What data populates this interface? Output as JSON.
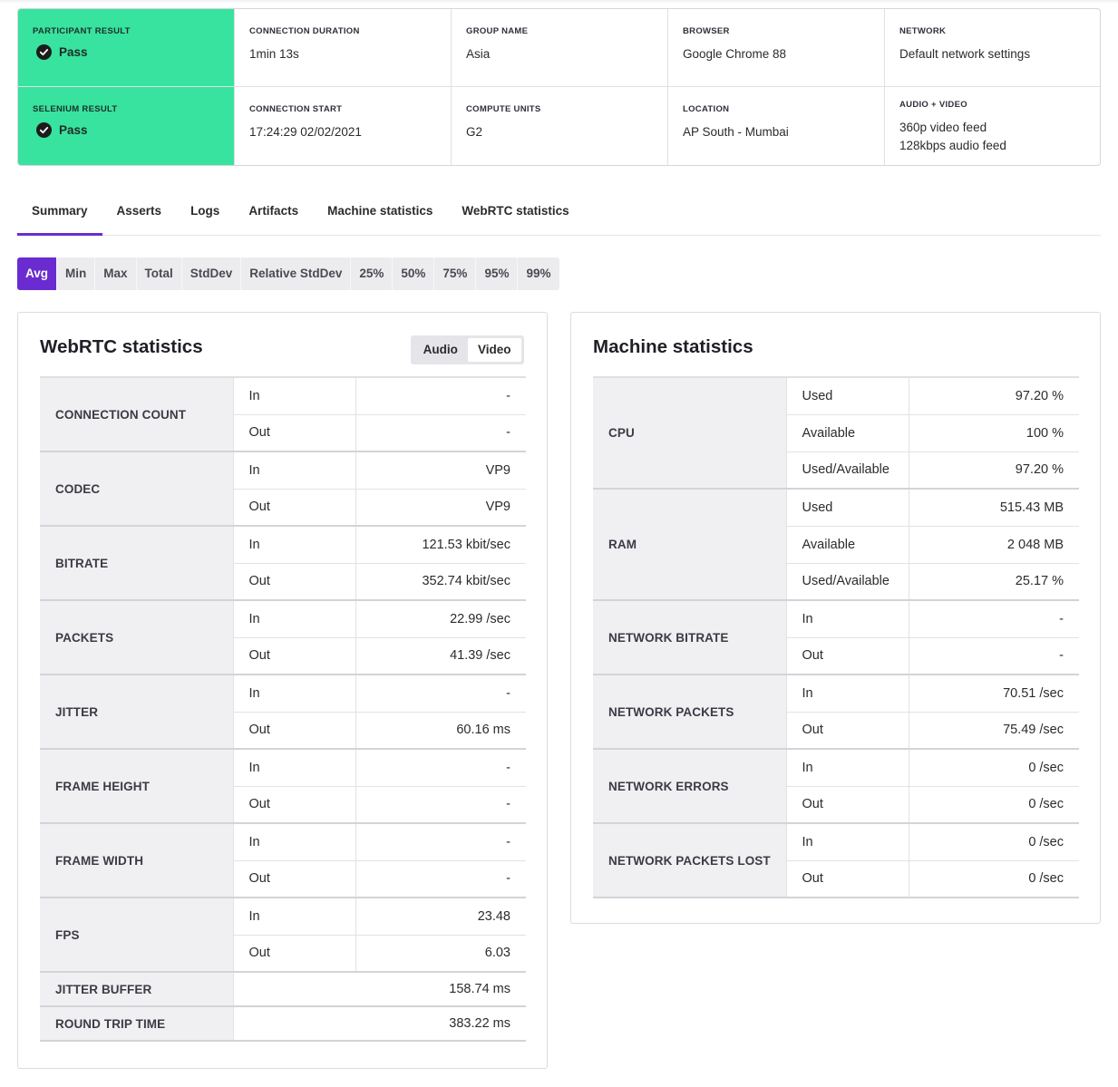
{
  "info": {
    "participant_result": {
      "label": "PARTICIPANT RESULT",
      "value": "Pass"
    },
    "connection_duration": {
      "label": "CONNECTION DURATION",
      "value": "1min 13s"
    },
    "group_name": {
      "label": "GROUP NAME",
      "value": "Asia"
    },
    "browser": {
      "label": "BROWSER",
      "value": "Google Chrome 88"
    },
    "network": {
      "label": "NETWORK",
      "value": "Default network settings"
    },
    "selenium_result": {
      "label": "SELENIUM RESULT",
      "value": "Pass"
    },
    "connection_start": {
      "label": "CONNECTION START",
      "value": "17:24:29 02/02/2021"
    },
    "compute_units": {
      "label": "COMPUTE UNITS",
      "value": "G2"
    },
    "location": {
      "label": "LOCATION",
      "value": "AP South - Mumbai"
    },
    "audio_video": {
      "label": "AUDIO + VIDEO",
      "value_line1": "360p video feed",
      "value_line2": "128kbps audio feed"
    }
  },
  "tabs": [
    "Summary",
    "Asserts",
    "Logs",
    "Artifacts",
    "Machine statistics",
    "WebRTC statistics"
  ],
  "active_tab": "Summary",
  "stat_tabs": [
    "Avg",
    "Min",
    "Max",
    "Total",
    "StdDev",
    "Relative StdDev",
    "25%",
    "50%",
    "75%",
    "95%",
    "99%"
  ],
  "active_stat": "Avg",
  "webrtc": {
    "title": "WebRTC statistics",
    "toggle": [
      "Audio",
      "Video"
    ],
    "active_toggle": "Video",
    "groups": [
      {
        "metric": "CONNECTION COUNT",
        "rows": [
          {
            "dir": "In",
            "value": "-"
          },
          {
            "dir": "Out",
            "value": "-"
          }
        ]
      },
      {
        "metric": "CODEC",
        "rows": [
          {
            "dir": "In",
            "value": "VP9"
          },
          {
            "dir": "Out",
            "value": "VP9"
          }
        ]
      },
      {
        "metric": "BITRATE",
        "rows": [
          {
            "dir": "In",
            "value": "121.53 kbit/sec"
          },
          {
            "dir": "Out",
            "value": "352.74 kbit/sec"
          }
        ]
      },
      {
        "metric": "PACKETS",
        "rows": [
          {
            "dir": "In",
            "value": "22.99 /sec"
          },
          {
            "dir": "Out",
            "value": "41.39 /sec"
          }
        ]
      },
      {
        "metric": "JITTER",
        "rows": [
          {
            "dir": "In",
            "value": "-"
          },
          {
            "dir": "Out",
            "value": "60.16 ms"
          }
        ]
      },
      {
        "metric": "FRAME HEIGHT",
        "rows": [
          {
            "dir": "In",
            "value": "-"
          },
          {
            "dir": "Out",
            "value": "-"
          }
        ]
      },
      {
        "metric": "FRAME WIDTH",
        "rows": [
          {
            "dir": "In",
            "value": "-"
          },
          {
            "dir": "Out",
            "value": "-"
          }
        ]
      },
      {
        "metric": "FPS",
        "rows": [
          {
            "dir": "In",
            "value": "23.48"
          },
          {
            "dir": "Out",
            "value": "6.03"
          }
        ]
      }
    ],
    "singles": [
      {
        "metric": "JITTER BUFFER",
        "value": "158.74 ms"
      },
      {
        "metric": "ROUND TRIP TIME",
        "value": "383.22 ms"
      }
    ]
  },
  "machine": {
    "title": "Machine statistics",
    "groups": [
      {
        "metric": "CPU",
        "rows": [
          {
            "dir": "Used",
            "value": "97.20 %"
          },
          {
            "dir": "Available",
            "value": "100 %"
          },
          {
            "dir": "Used/Available",
            "value": "97.20 %"
          }
        ]
      },
      {
        "metric": "RAM",
        "rows": [
          {
            "dir": "Used",
            "value": "515.43 MB"
          },
          {
            "dir": "Available",
            "value": "2 048 MB"
          },
          {
            "dir": "Used/Available",
            "value": "25.17 %"
          }
        ]
      },
      {
        "metric": "NETWORK BITRATE",
        "rows": [
          {
            "dir": "In",
            "value": "-"
          },
          {
            "dir": "Out",
            "value": "-"
          }
        ]
      },
      {
        "metric": "NETWORK PACKETS",
        "rows": [
          {
            "dir": "In",
            "value": "70.51 /sec"
          },
          {
            "dir": "Out",
            "value": "75.49 /sec"
          }
        ]
      },
      {
        "metric": "NETWORK ERRORS",
        "rows": [
          {
            "dir": "In",
            "value": "0 /sec"
          },
          {
            "dir": "Out",
            "value": "0 /sec"
          }
        ]
      },
      {
        "metric": "NETWORK PACKETS LOST",
        "rows": [
          {
            "dir": "In",
            "value": "0 /sec"
          },
          {
            "dir": "Out",
            "value": "0 /sec"
          }
        ]
      }
    ]
  },
  "colors": {
    "pass_bg": "#37e39f",
    "accent": "#6a2cd0"
  },
  "icons": {
    "pass": "check-circle-icon"
  }
}
